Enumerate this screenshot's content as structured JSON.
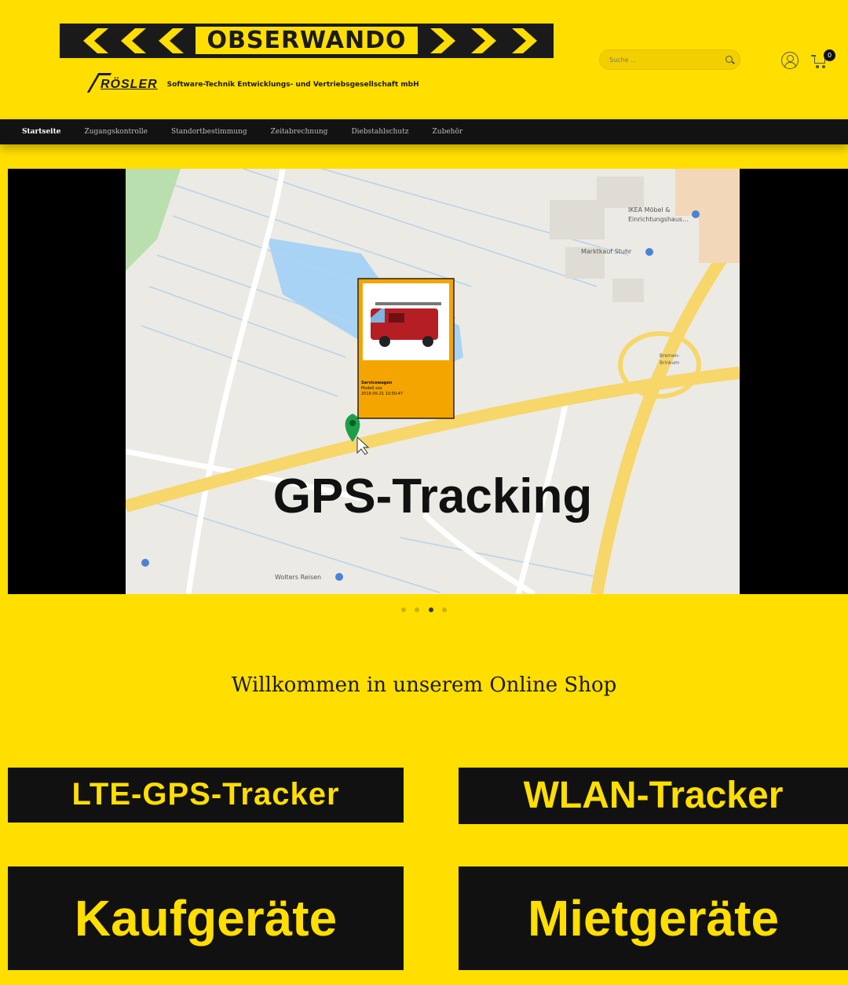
{
  "header": {
    "logo_text": "OBSERWANDO",
    "company_name": "RÖSLER",
    "company_subtitle": "Software-Technik Entwicklungs- und Vertriebsgesellschaft mbH",
    "search_placeholder": "Suche ...",
    "cart_count": "0"
  },
  "nav": {
    "items": [
      {
        "label": "Startseite",
        "active": true
      },
      {
        "label": "Zugangskontrolle"
      },
      {
        "label": "Standortbestimmung"
      },
      {
        "label": "Zeitabrechnung"
      },
      {
        "label": "Diebstahlschutz"
      },
      {
        "label": "Zubehör"
      }
    ]
  },
  "slider": {
    "headline": "GPS-Tracking",
    "popup_title": "Servicewagen",
    "popup_line2": "Modell xxx",
    "popup_line3": "2019-05-21 10:50:47",
    "map_labels": {
      "ikea": "IKEA Möbel &",
      "ikea2": "Einrichtungshaus...",
      "marktkauf": "Marktkauf Stuhr",
      "wolters": "Wolters Reisen",
      "bremen": "Bremen-",
      "bremen2": "Brinkum"
    },
    "slides_count": 4,
    "active_slide": 3
  },
  "welcome": "Willkommen in unserem Online Shop",
  "tiles": {
    "lte": "LTE-GPS-Tracker",
    "wlan": "WLAN-Tracker",
    "kauf": "Kaufgeräte",
    "miet": "Mietgeräte"
  },
  "colors": {
    "brand_yellow": "#ffde00",
    "dark": "#111111",
    "marker_green": "#1f9e4a",
    "popup_orange": "#f5a500"
  }
}
